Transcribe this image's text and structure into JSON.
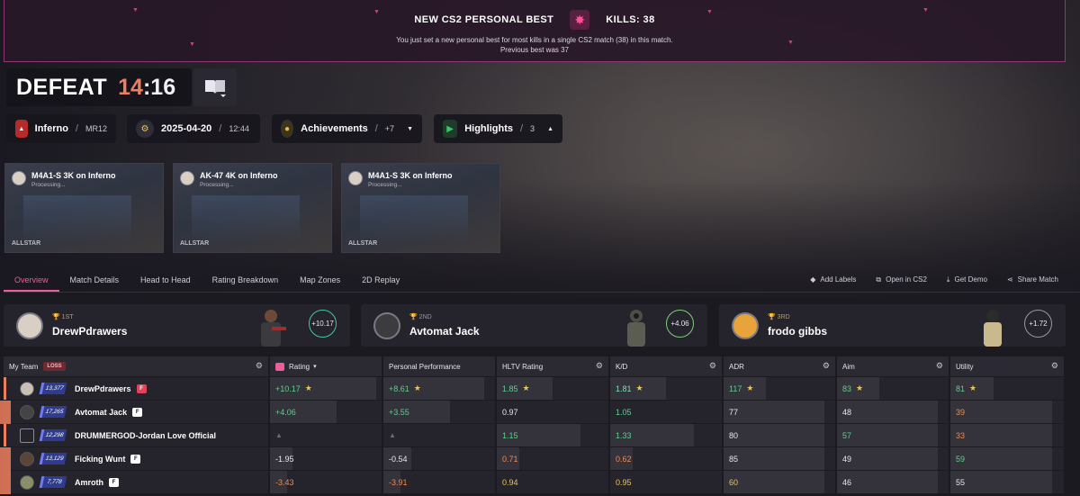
{
  "banner": {
    "title": "NEW CS2 PERSONAL BEST",
    "kills": "KILLS: 38",
    "message": "You just set a new personal best for most kills in a single CS2 match (38) in this match.",
    "previous": "Previous best was 37",
    "accent": "#d33b7e"
  },
  "result": {
    "word": "DEFEAT",
    "score_team": "14",
    "score_sep": ":",
    "score_enemy": "16"
  },
  "info": {
    "map": "Inferno",
    "map_sep": "/",
    "mode": "MR12",
    "date": "2025-04-20",
    "date_sep": "/",
    "time": "12:44",
    "achievements_label": "Achievements",
    "achievements_sep": "/",
    "achievements_count": "+7",
    "highlights_label": "Highlights",
    "highlights_sep": "/",
    "highlights_count": "3"
  },
  "clips": [
    {
      "title": "M4A1-S 3K on Inferno",
      "status": "Processing...",
      "brand": "ALLSTAR"
    },
    {
      "title": "AK-47 4K on Inferno",
      "status": "Processing...",
      "brand": "ALLSTAR"
    },
    {
      "title": "M4A1-S 3K on Inferno",
      "status": "Processing...",
      "brand": "ALLSTAR"
    }
  ],
  "tabs": [
    "Overview",
    "Match Details",
    "Head to Head",
    "Rating Breakdown",
    "Map Zones",
    "2D Replay"
  ],
  "actions": {
    "add_labels": "Add Labels",
    "open_cs2": "Open in CS2",
    "get_demo": "Get Demo",
    "share": "Share Match"
  },
  "podium": [
    {
      "rank": "1ST",
      "name": "DrewPdrawers",
      "delta": "+10.17"
    },
    {
      "rank": "2ND",
      "name": "Avtomat Jack",
      "delta": "+4.06"
    },
    {
      "rank": "3RD",
      "name": "frodo gibbs",
      "delta": "+1.72"
    }
  ],
  "table": {
    "team_label": "My Team",
    "loss_badge": "LOSS",
    "headers": [
      "Rating",
      "Personal Performance",
      "HLTV Rating",
      "K/D",
      "ADR",
      "Aim",
      "Utility"
    ],
    "rows": [
      {
        "elo": "13,377",
        "name": "DrewPdrawers",
        "rating": "+10.17",
        "perf": "+8.61",
        "hltv": "1.85",
        "kd": "1.81",
        "adr": "117",
        "aim": "83",
        "util": "81",
        "rating_pct": 0.95,
        "perf_pct": 0.9
      },
      {
        "elo": "17,265",
        "name": "Avtomat Jack",
        "rating": "+4.06",
        "perf": "+3.55",
        "hltv": "0.97",
        "kd": "1.05",
        "adr": "77",
        "aim": "48",
        "util": "39",
        "rating_pct": 0.6,
        "perf_pct": 0.6
      },
      {
        "elo": "12,298",
        "name": "DRUMMERGOD-Jordan Love Official",
        "rating": "",
        "perf": "",
        "hltv": "1.15",
        "kd": "1.33",
        "adr": "80",
        "aim": "57",
        "util": "33",
        "rating_pct": 0,
        "perf_pct": 0
      },
      {
        "elo": "13,129",
        "name": "Ficking Wunt",
        "rating": "-1.95",
        "perf": "-0.54",
        "hltv": "0.71",
        "kd": "0.62",
        "adr": "85",
        "aim": "49",
        "util": "59",
        "rating_pct": 0.2,
        "perf_pct": 0.25
      },
      {
        "elo": "7,778",
        "name": "Amroth",
        "rating": "-3.43",
        "perf": "-3.91",
        "hltv": "0.94",
        "kd": "0.95",
        "adr": "60",
        "aim": "46",
        "util": "55",
        "rating_pct": 0.15,
        "perf_pct": 0.15
      }
    ]
  }
}
